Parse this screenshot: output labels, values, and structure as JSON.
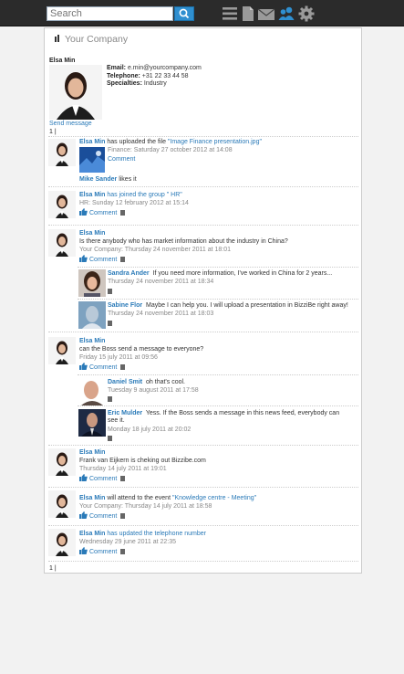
{
  "search": {
    "placeholder": "Search"
  },
  "toolbar_icons": [
    "list-icon",
    "document-icon",
    "mail-icon",
    "people-icon",
    "gear-icon"
  ],
  "brand": {
    "text": "Your Company"
  },
  "profile": {
    "name": "Elsa Min",
    "email_label": "Email:",
    "email": "e.min@yourcompany.com",
    "telephone_label": "Telephone:",
    "telephone": "+31 22 33 44 58",
    "specialties_label": "Specialties:",
    "specialties": "Industry",
    "send_message": "Send message"
  },
  "pager": "1 |",
  "feed": [
    {
      "author": "Elsa Min",
      "text": "has uploaded the file ",
      "link": "\"Image Finance presentation.jpg\"",
      "meta": "Finance: Saturday 27 october 2012 at 14:08",
      "comment": "Comment",
      "likes_name": "Mike Sander",
      "likes_text": " likes it"
    },
    {
      "author": "Elsa Min",
      "text": "has joined the group \" HR\"",
      "meta": "HR: Sunday 12 february 2012 at 15:14",
      "comment": "Comment"
    },
    {
      "author": "Elsa Min",
      "text": "Is there anybody who has market information about the industry in China?",
      "meta": "Your Company: Thursday 24 november 2011 at 18:01",
      "comment": "Comment",
      "replies": [
        {
          "author": "Sandra Ander",
          "text": "If you need more information, I've worked in China for 2 years...",
          "meta": "Thursday 24 november 2011 at 18:34"
        },
        {
          "author": "Sabine Flor",
          "text": "Maybe I can help you. I will upload a presentation in BizziBe right away!",
          "meta": "Thursday 24 november 2011 at 18:03"
        }
      ]
    },
    {
      "author": "Elsa Min",
      "text": "can the Boss send a message to everyone?",
      "meta": "Friday 15 july 2011 at 09:56",
      "comment": "Comment",
      "replies": [
        {
          "author": "Daniel Smit",
          "text": "oh that's cool.",
          "meta": "Tuesday 9 august 2011 at 17:58"
        },
        {
          "author": "Eric Mulder",
          "text": "Yess. If the Boss sends a message in this news feed, everybody can see it.",
          "meta": "Monday 18 july 2011 at 20:02"
        }
      ]
    },
    {
      "author": "Elsa Min",
      "text": "Frank van Eijkern is cheking out Bizzibe.com",
      "meta": "Thursday 14 july 2011 at 19:01",
      "comment": "Comment"
    },
    {
      "author": "Elsa Min",
      "text": "will attend to the event ",
      "link": "\"Knowledge centre - Meeting\"",
      "meta": "Your Company: Thursday 14 july 2011 at 18:58",
      "comment": "Comment"
    },
    {
      "author": "Elsa Min",
      "text": "has updated the telephone number",
      "meta": "Wednesday 29 june 2011 at 22:35",
      "comment": "Comment"
    }
  ],
  "colors": {
    "link": "#2a7ab8",
    "topbar": "#2b2b2b",
    "search_button": "#2f8fd0"
  }
}
